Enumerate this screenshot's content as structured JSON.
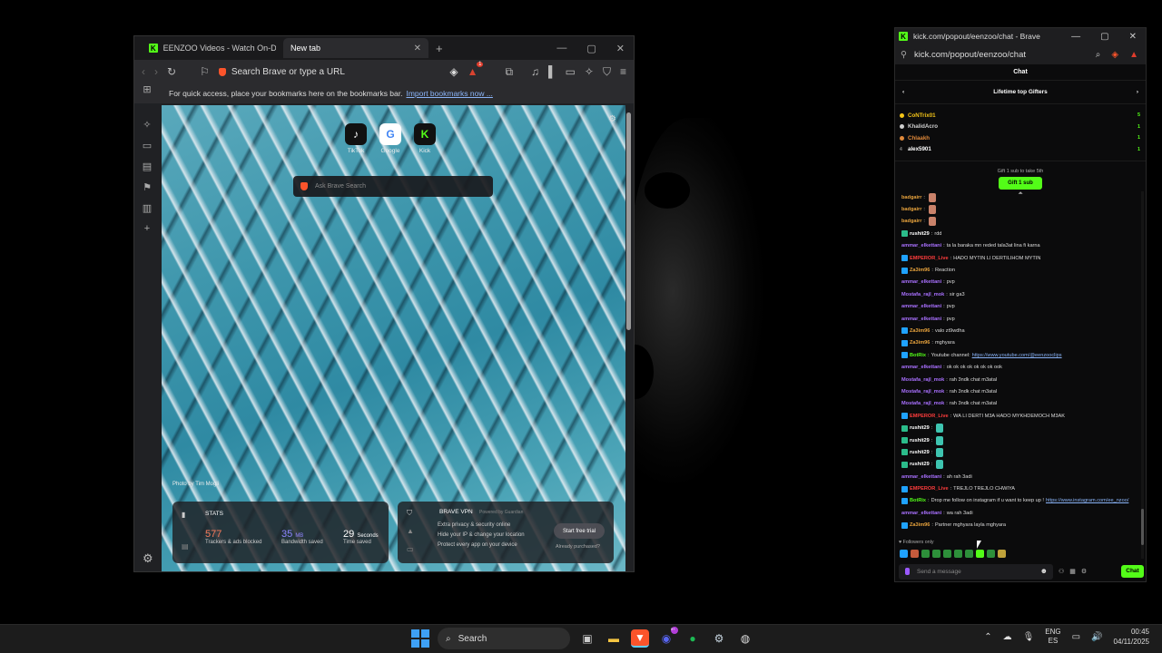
{
  "browser1": {
    "tabs": [
      {
        "label": "EENZOO Videos - Watch On-Demand"
      },
      {
        "label": "New tab"
      }
    ],
    "address_placeholder": "Search Brave or type a URL",
    "shield_count": "1",
    "bookmarks_hint": "For quick access, place your bookmarks here on the bookmarks bar.",
    "bookmarks_link": "Import bookmarks now ...",
    "shortcuts": [
      {
        "label": "TikTok",
        "glyph": "♪"
      },
      {
        "label": "Google",
        "glyph": "G"
      },
      {
        "label": "Kick",
        "glyph": "K"
      }
    ],
    "ntp_search_placeholder": "Ask Brave Search",
    "photo_credit": "Photo by Tim Mogli",
    "stats": {
      "title": "STATS",
      "trackers_value": "577",
      "trackers_label": "Trackers & ads blocked",
      "bandwidth_value": "35",
      "bandwidth_unit": "MB",
      "bandwidth_label": "Bandwidth saved",
      "time_value": "29",
      "time_unit": "Seconds",
      "time_label": "Time saved"
    },
    "vpn": {
      "title": "BRAVE VPN",
      "powered": "Powered by Guardian",
      "line1": "Extra privacy & security online",
      "line2": "Hide your IP & change your location",
      "line3": "Protect every app on your device",
      "button": "Start free trial",
      "link": "Already purchased?"
    }
  },
  "browser2": {
    "title": "kick.com/popout/eenzoo/chat - Brave",
    "url": "kick.com/popout/eenzoo/chat",
    "chat_header": "Chat",
    "gifters_title": "Lifetime top Gifters",
    "gifters": [
      {
        "name": "CoNTrix01",
        "color": "#f5c518",
        "count": "5"
      },
      {
        "name": "KhalidAcro",
        "color": "#cfcfcf",
        "count": "1"
      },
      {
        "name": "Chlaakh",
        "color": "#e0893a",
        "count": "1"
      },
      {
        "name": "alex5901",
        "color": "#ffffff",
        "count": "1"
      }
    ],
    "gift_hint": "Gift 1 sub to take 5th",
    "gift_button": "Gift 1 sub",
    "messages": [
      {
        "user": "badgairr",
        "color": "#e8a33d",
        "text": "",
        "badge": ""
      },
      {
        "user": "badgairr",
        "color": "#e8a33d",
        "text": "",
        "badge": ""
      },
      {
        "user": "badgairr",
        "color": "#e8a33d",
        "text": "",
        "badge": ""
      },
      {
        "user": "rushit29",
        "color": "#ffffff",
        "text": "rdd",
        "badge": "g"
      },
      {
        "user": "ammar_elkettani",
        "color": "#a970ff",
        "text": "ta la baraka mn reded tala3at lina fi karna",
        "badge": ""
      },
      {
        "user": "EMPEROR_Live",
        "color": "#ff3c3c",
        "text": "HADO MYTIN LI DERTILIHOM MYTIN",
        "badge": "b"
      },
      {
        "user": "Za3im96",
        "color": "#e8a33d",
        "text": "Reaction",
        "badge": "b"
      },
      {
        "user": "ammar_elkettani",
        "color": "#a970ff",
        "text": "pvp",
        "badge": ""
      },
      {
        "user": "Mostafa_rajl_mok",
        "color": "#a970ff",
        "text": "sir ga3",
        "badge": ""
      },
      {
        "user": "ammar_elkettani",
        "color": "#a970ff",
        "text": "pvp",
        "badge": ""
      },
      {
        "user": "ammar_elkettani",
        "color": "#a970ff",
        "text": "pvp",
        "badge": ""
      },
      {
        "user": "Za3im96",
        "color": "#e8a33d",
        "text": "valo zt9wdha",
        "badge": "b"
      },
      {
        "user": "Za3im96",
        "color": "#e8a33d",
        "text": "mghyara",
        "badge": "b"
      },
      {
        "user": "BotRix",
        "color": "#53fc18",
        "text": "Youtube channel:",
        "link": "https://www.youtube.com/@eenzooclips",
        "badge": "b"
      },
      {
        "user": "ammar_elkettani",
        "color": "#a970ff",
        "text": "ok ok ok ok ok ok ok ook",
        "badge": ""
      },
      {
        "user": "Mostafa_rajl_mok",
        "color": "#a970ff",
        "text": "rah 3ndk chat m3atal",
        "badge": ""
      },
      {
        "user": "Mostafa_rajl_mok",
        "color": "#a970ff",
        "text": "rah 3ndk chat m3atal",
        "badge": ""
      },
      {
        "user": "Mostafa_rajl_mok",
        "color": "#a970ff",
        "text": "rah 3ndk chat m3atal",
        "badge": ""
      },
      {
        "user": "EMPEROR_Live",
        "color": "#ff3c3c",
        "text": "WA LI DERTI M3A HADO MYKHDEMOCH M3AK",
        "badge": "b"
      },
      {
        "user": "rushit29",
        "color": "#ffffff",
        "text": "",
        "badge": "g"
      },
      {
        "user": "rushit29",
        "color": "#ffffff",
        "text": "",
        "badge": "g"
      },
      {
        "user": "rushit29",
        "color": "#ffffff",
        "text": "",
        "badge": "g"
      },
      {
        "user": "rushit29",
        "color": "#ffffff",
        "text": "",
        "badge": "g"
      },
      {
        "user": "ammar_elkettani",
        "color": "#a970ff",
        "text": "ah rah 3adi",
        "badge": ""
      },
      {
        "user": "EMPEROR_Live",
        "color": "#ff3c3c",
        "text": "TREJLO TREJLO CHWIYA",
        "badge": "b"
      },
      {
        "user": "BotRix",
        "color": "#53fc18",
        "text": "Drop me follow on instagram if u want to keep up !",
        "link": "https://www.instagram.com/ee_nzoo/",
        "badge": "b"
      },
      {
        "user": "ammar_elkettani",
        "color": "#a970ff",
        "text": "wa rah 3adi",
        "badge": ""
      },
      {
        "user": "Za3im96",
        "color": "#e8a33d",
        "text": "Partner mghyara layla mghyara",
        "badge": "b"
      }
    ],
    "followers_only": "Followers only",
    "input_placeholder": "Send a message",
    "chat_button": "Chat"
  },
  "taskbar": {
    "search_label": "Search",
    "lang_top": "ENG",
    "lang_bottom": "ES",
    "time": "00:45",
    "date": "04/11/2025",
    "discord_badge": "9+"
  }
}
